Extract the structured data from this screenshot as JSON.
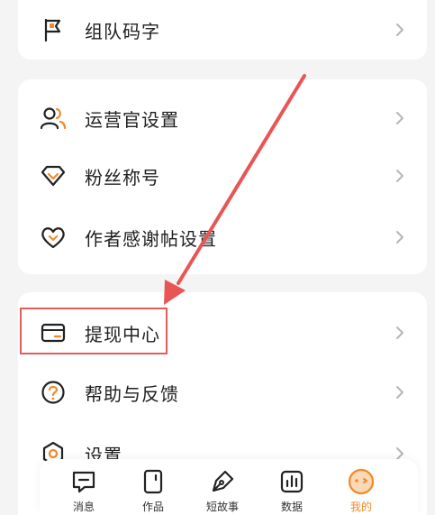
{
  "menu": {
    "team": {
      "label": "组队码字",
      "icon": "flag-icon"
    },
    "operator": {
      "label": "运营官设置",
      "icon": "users-icon"
    },
    "fan_title": {
      "label": "粉丝称号",
      "icon": "diamond-icon"
    },
    "thanks": {
      "label": "作者感谢帖设置",
      "icon": "heart-icon"
    },
    "withdraw": {
      "label": "提现中心",
      "icon": "wallet-icon"
    },
    "help": {
      "label": "帮助与反馈",
      "icon": "help-icon"
    },
    "settings": {
      "label": "设置",
      "icon": "settings-icon"
    }
  },
  "tabbar": {
    "tabs": [
      {
        "label": "消息",
        "icon": "message-icon"
      },
      {
        "label": "作品",
        "icon": "book-icon"
      },
      {
        "label": "短故事",
        "icon": "pen-icon"
      },
      {
        "label": "数据",
        "icon": "chart-icon"
      },
      {
        "label": "我的",
        "icon": "profile-face-icon"
      }
    ],
    "active_index": 4
  },
  "colors": {
    "accent": "#f08a2a",
    "highlight": "#e35b5b",
    "arrow": "#e85555",
    "background": "#f4f4f5"
  }
}
